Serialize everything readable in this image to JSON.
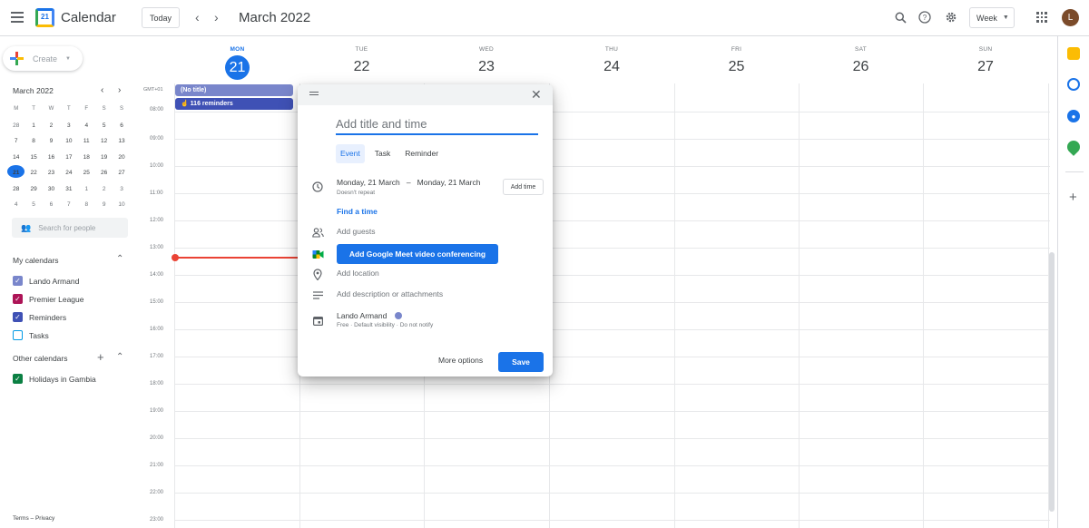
{
  "header": {
    "app_title": "Calendar",
    "logo_day": "21",
    "today_label": "Today",
    "month_label": "March 2022",
    "view_label": "Week",
    "avatar_initial": "L"
  },
  "sidebar": {
    "create_label": "Create",
    "mini_month": "March 2022",
    "mini_dow": [
      "M",
      "T",
      "W",
      "T",
      "F",
      "S",
      "S"
    ],
    "mini_weeks": [
      [
        "28",
        "1",
        "2",
        "3",
        "4",
        "5",
        "6"
      ],
      [
        "7",
        "8",
        "9",
        "10",
        "11",
        "12",
        "13"
      ],
      [
        "14",
        "15",
        "16",
        "17",
        "18",
        "19",
        "20"
      ],
      [
        "21",
        "22",
        "23",
        "24",
        "25",
        "26",
        "27"
      ],
      [
        "28",
        "29",
        "30",
        "31",
        "1",
        "2",
        "3"
      ],
      [
        "4",
        "5",
        "6",
        "7",
        "8",
        "9",
        "10"
      ]
    ],
    "search_placeholder": "Search for people",
    "my_calendars_label": "My calendars",
    "my_calendars": [
      {
        "label": "Lando Armand",
        "color": "#7986cb",
        "checked": true
      },
      {
        "label": "Premier League",
        "color": "#ad1457",
        "checked": true
      },
      {
        "label": "Reminders",
        "color": "#3f51b5",
        "checked": true
      },
      {
        "label": "Tasks",
        "color": "#039be5",
        "checked": false
      }
    ],
    "other_calendars_label": "Other calendars",
    "other_calendars": [
      {
        "label": "Holidays in Gambia",
        "color": "#0b8043",
        "checked": true
      }
    ],
    "footer_terms": "Terms",
    "footer_sep": "–",
    "footer_privacy": "Privacy"
  },
  "week": {
    "timezone": "GMT+01",
    "days": [
      {
        "name": "MON",
        "date": "21",
        "today": true
      },
      {
        "name": "TUE",
        "date": "22"
      },
      {
        "name": "WED",
        "date": "23"
      },
      {
        "name": "THU",
        "date": "24"
      },
      {
        "name": "FRI",
        "date": "25"
      },
      {
        "name": "SAT",
        "date": "26"
      },
      {
        "name": "SUN",
        "date": "27"
      }
    ],
    "hours": [
      "08:00",
      "09:00",
      "10:00",
      "11:00",
      "12:00",
      "13:00",
      "14:00",
      "15:00",
      "16:00",
      "17:00",
      "18:00",
      "19:00",
      "20:00",
      "21:00",
      "22:00",
      "23:00"
    ],
    "allday_events": [
      {
        "label": "(No title)",
        "color": "#7986cb"
      },
      {
        "label": "116 reminders",
        "color": "#3f51b5"
      }
    ]
  },
  "dialog": {
    "title_placeholder": "Add title and time",
    "tabs": [
      "Event",
      "Task",
      "Reminder"
    ],
    "date_range": "Monday, 21 March   –   Monday, 21 March",
    "repeat": "Doesn't repeat",
    "add_time": "Add time",
    "find_time": "Find a time",
    "add_guests": "Add guests",
    "meet_button": "Add Google Meet video conferencing",
    "add_location": "Add location",
    "add_description": "Add description or attachments",
    "calendar_name": "Lando Armand",
    "calendar_status": "Free · Default visibility · Do not notify",
    "more_options": "More options",
    "save": "Save"
  },
  "colors": {
    "accent": "#1a73e8",
    "now_line": "#ea4335"
  }
}
